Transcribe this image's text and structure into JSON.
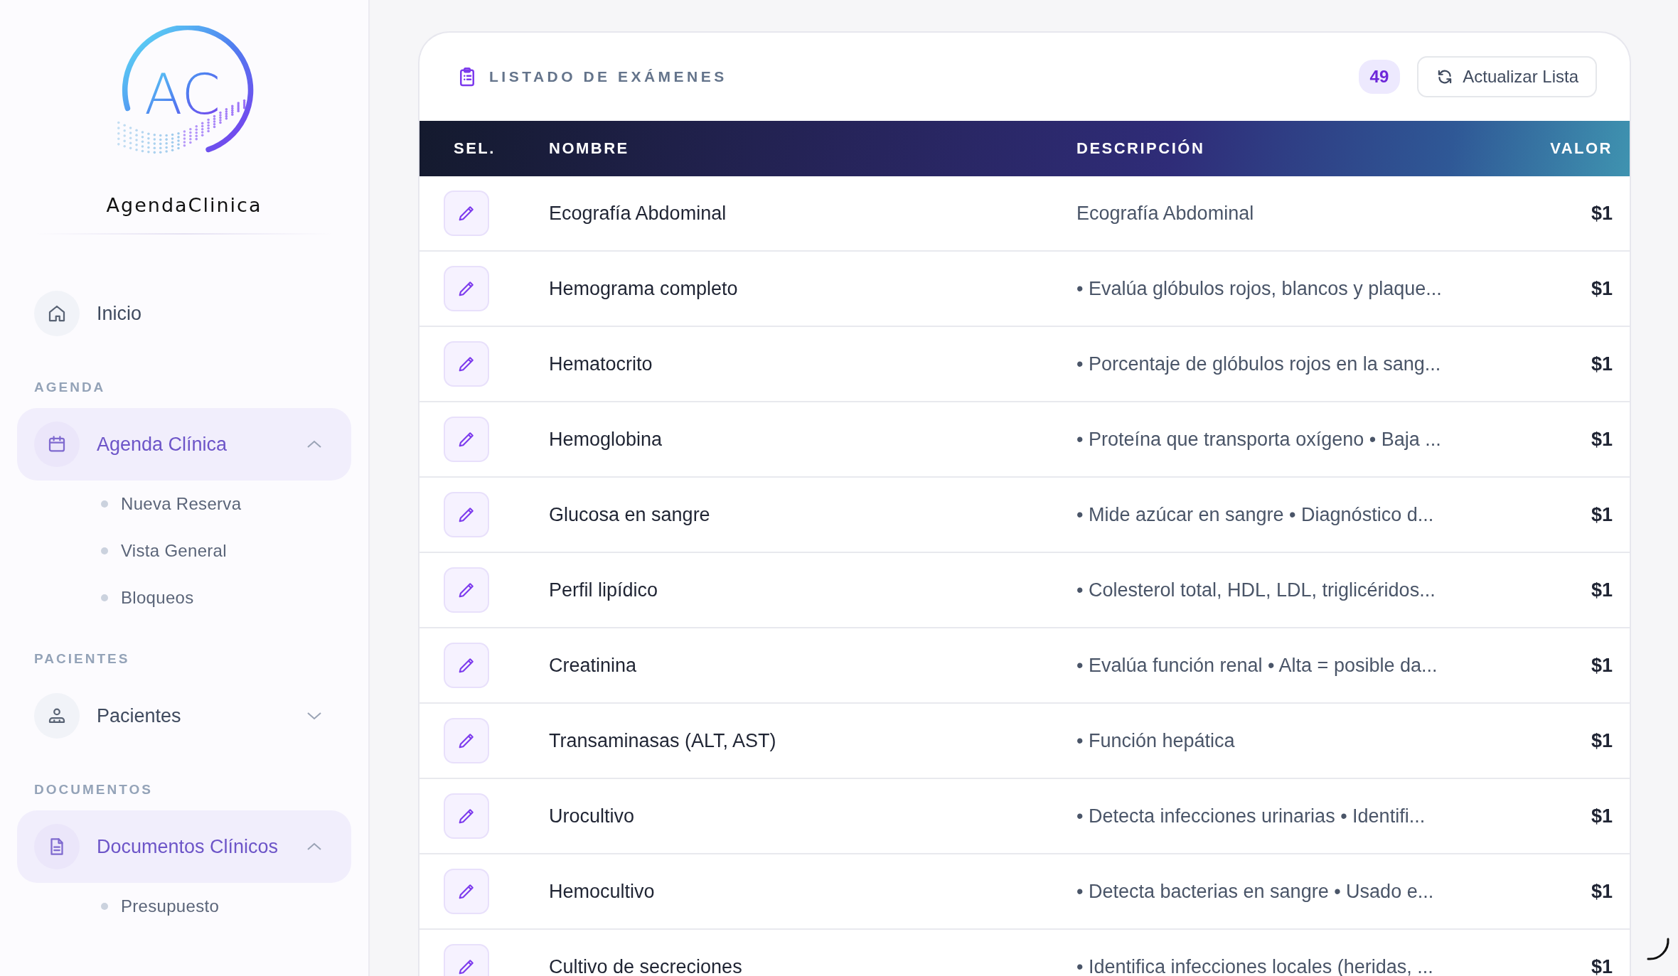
{
  "sidebar": {
    "brand": {
      "monogram": "AC",
      "name": "AgendaClinica"
    },
    "sections": [
      {
        "items": [
          {
            "kind": "link",
            "label": "Inicio"
          }
        ]
      },
      {
        "title": "AGENDA",
        "items": [
          {
            "kind": "group",
            "label": "Agenda Clínica",
            "expanded": true,
            "children": [
              "Nueva Reserva",
              "Vista General",
              "Bloqueos"
            ]
          }
        ]
      },
      {
        "title": "PACIENTES",
        "items": [
          {
            "kind": "group",
            "label": "Pacientes",
            "expanded": false
          }
        ]
      },
      {
        "title": "DOCUMENTOS",
        "items": [
          {
            "kind": "group",
            "label": "Documentos Clínicos",
            "expanded": true,
            "children": [
              "Presupuesto"
            ]
          }
        ]
      }
    ]
  },
  "card": {
    "title": "LISTADO DE EXÁMENES",
    "count": "49",
    "refresh_button": "Actualizar Lista",
    "table": {
      "columns": [
        "SEL.",
        "NOMBRE",
        "DESCRIPCIÓN",
        "VALOR"
      ],
      "rows": [
        {
          "name": "Ecografía Abdominal",
          "description": "Ecografía Abdominal",
          "value": "$1"
        },
        {
          "name": "Hemograma completo",
          "description": "• Evalúa glóbulos rojos, blancos y plaque...",
          "value": "$1"
        },
        {
          "name": "Hematocrito",
          "description": "• Porcentaje de glóbulos rojos en la sang...",
          "value": "$1"
        },
        {
          "name": "Hemoglobina",
          "description": "• Proteína que transporta oxígeno • Baja ...",
          "value": "$1"
        },
        {
          "name": "Glucosa en sangre",
          "description": "• Mide azúcar en sangre • Diagnóstico d...",
          "value": "$1"
        },
        {
          "name": "Perfil lipídico",
          "description": "• Colesterol total, HDL, LDL, triglicéridos...",
          "value": "$1"
        },
        {
          "name": "Creatinina",
          "description": "• Evalúa función renal • Alta = posible da...",
          "value": "$1"
        },
        {
          "name": "Transaminasas (ALT, AST)",
          "description": "• Función hepática",
          "value": "$1"
        },
        {
          "name": "Urocultivo",
          "description": "• Detecta infecciones urinarias • Identifi...",
          "value": "$1"
        },
        {
          "name": "Hemocultivo",
          "description": "• Detecta bacterias en sangre • Usado e...",
          "value": "$1"
        },
        {
          "name": "Cultivo de secreciones",
          "description": "• Identifica infecciones locales (heridas, ...",
          "value": "$1"
        }
      ]
    }
  }
}
